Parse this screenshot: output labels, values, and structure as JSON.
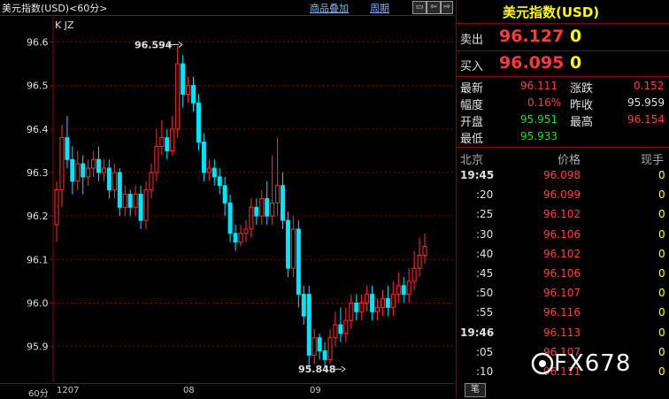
{
  "header": {
    "title": "美元指数(USD)<60分>",
    "links": [
      "商品叠加",
      "周期"
    ],
    "btns": [
      "▭",
      "⇦",
      "⇨",
      "▭"
    ]
  },
  "chart": {
    "indicator": "K JZ",
    "high_marker": "96.594",
    "low_marker": "95.848",
    "yticks": [
      "96.6",
      "96.5",
      "96.4",
      "96.3",
      "96.2",
      "96.1",
      "96.0",
      "95.9"
    ],
    "xlabels": [
      "60分",
      "1207",
      "08",
      "09"
    ],
    "colors": {
      "up": "#ff3030",
      "down": "#00e5ff",
      "grid": "#8b0000",
      "axis": "#8b0000"
    }
  },
  "chart_data": {
    "type": "candlestick",
    "ylim": [
      95.82,
      96.66
    ],
    "yticks": [
      96.6,
      96.5,
      96.4,
      96.3,
      96.2,
      96.1,
      96.0,
      95.9
    ],
    "candles": [
      [
        96.18,
        96.26,
        96.14,
        96.28
      ],
      [
        96.26,
        96.38,
        96.22,
        96.41
      ],
      [
        96.38,
        96.33,
        96.31,
        96.43
      ],
      [
        96.33,
        96.28,
        96.25,
        96.36
      ],
      [
        96.28,
        96.32,
        96.26,
        96.35
      ],
      [
        96.32,
        96.29,
        96.25,
        96.34
      ],
      [
        96.29,
        96.31,
        96.27,
        96.33
      ],
      [
        96.31,
        96.33,
        96.29,
        96.35
      ],
      [
        96.33,
        96.3,
        96.28,
        96.36
      ],
      [
        96.3,
        96.31,
        96.28,
        96.33
      ],
      [
        96.31,
        96.26,
        96.24,
        96.33
      ],
      [
        96.26,
        96.3,
        96.24,
        96.32
      ],
      [
        96.3,
        96.22,
        96.2,
        96.31
      ],
      [
        96.22,
        96.25,
        96.2,
        96.27
      ],
      [
        96.25,
        96.22,
        96.2,
        96.26
      ],
      [
        96.22,
        96.25,
        96.2,
        96.27
      ],
      [
        96.25,
        96.19,
        96.17,
        96.27
      ],
      [
        96.19,
        96.26,
        96.17,
        96.28
      ],
      [
        96.26,
        96.3,
        96.24,
        96.32
      ],
      [
        96.3,
        96.36,
        96.28,
        96.4
      ],
      [
        96.36,
        96.38,
        96.34,
        96.42
      ],
      [
        96.38,
        96.35,
        96.33,
        96.4
      ],
      [
        96.35,
        96.4,
        96.34,
        96.43
      ],
      [
        96.4,
        96.55,
        96.38,
        96.59
      ],
      [
        96.55,
        96.48,
        96.45,
        96.57
      ],
      [
        96.48,
        96.5,
        96.46,
        96.52
      ],
      [
        96.5,
        96.46,
        96.44,
        96.52
      ],
      [
        96.46,
        96.37,
        96.35,
        96.48
      ],
      [
        96.37,
        96.3,
        96.28,
        96.39
      ],
      [
        96.3,
        96.31,
        96.28,
        96.33
      ],
      [
        96.31,
        96.29,
        96.27,
        96.33
      ],
      [
        96.29,
        96.27,
        96.25,
        96.31
      ],
      [
        96.27,
        96.23,
        96.2,
        96.29
      ],
      [
        96.23,
        96.16,
        96.14,
        96.25
      ],
      [
        96.16,
        96.14,
        96.12,
        96.18
      ],
      [
        96.14,
        96.16,
        96.13,
        96.18
      ],
      [
        96.16,
        96.17,
        96.14,
        96.19
      ],
      [
        96.17,
        96.22,
        96.15,
        96.24
      ],
      [
        96.22,
        96.2,
        96.18,
        96.24
      ],
      [
        96.2,
        96.24,
        96.18,
        96.26
      ],
      [
        96.24,
        96.2,
        96.18,
        96.28
      ],
      [
        96.2,
        96.23,
        96.18,
        96.34
      ],
      [
        96.23,
        96.27,
        96.2,
        96.38
      ],
      [
        96.27,
        96.19,
        96.17,
        96.3
      ],
      [
        96.19,
        96.08,
        96.06,
        96.21
      ],
      [
        96.08,
        96.17,
        96.06,
        96.2
      ],
      [
        96.17,
        96.02,
        95.99,
        96.19
      ],
      [
        96.02,
        95.97,
        95.95,
        96.04
      ],
      [
        96.02,
        95.88,
        95.85,
        96.04
      ],
      [
        95.88,
        95.92,
        95.86,
        95.94
      ],
      [
        95.92,
        95.89,
        95.87,
        95.93
      ],
      [
        95.89,
        95.87,
        95.85,
        95.91
      ],
      [
        95.87,
        95.92,
        95.86,
        95.94
      ],
      [
        95.92,
        95.95,
        95.9,
        95.98
      ],
      [
        95.95,
        95.93,
        95.91,
        95.99
      ],
      [
        95.93,
        95.96,
        95.91,
        95.99
      ],
      [
        95.96,
        96.0,
        95.94,
        96.02
      ],
      [
        96.0,
        95.98,
        95.96,
        96.02
      ],
      [
        95.98,
        96.0,
        95.96,
        96.02
      ],
      [
        96.0,
        96.02,
        95.98,
        96.04
      ],
      [
        96.02,
        95.98,
        95.96,
        96.04
      ],
      [
        95.98,
        95.99,
        95.96,
        96.01
      ],
      [
        95.99,
        96.01,
        95.97,
        96.03
      ],
      [
        96.01,
        95.99,
        95.97,
        96.04
      ],
      [
        95.99,
        96.02,
        95.97,
        96.05
      ],
      [
        96.02,
        96.04,
        96.0,
        96.07
      ],
      [
        96.04,
        96.02,
        96.0,
        96.06
      ],
      [
        96.02,
        96.05,
        96.0,
        96.08
      ],
      [
        96.05,
        96.08,
        96.03,
        96.12
      ],
      [
        96.08,
        96.11,
        96.06,
        96.15
      ],
      [
        96.11,
        96.13,
        96.09,
        96.16
      ]
    ]
  },
  "panel": {
    "title": "美元指数(USD)",
    "sell_label": "卖出",
    "sell_price": "96.127",
    "sell_vol": "0",
    "buy_label": "买入",
    "buy_price": "96.095",
    "buy_vol": "0",
    "latest_label": "最新",
    "latest": "96.111",
    "change_label": "涨跌",
    "change": "0.152",
    "range_label": "幅度",
    "range": "0.16%",
    "prevclose_label": "昨收",
    "prevclose": "95.959",
    "open_label": "开盘",
    "open": "95.951",
    "high_label": "最高",
    "high": "96.154",
    "low_label": "最低",
    "low": "95.933",
    "col_time": "北京",
    "col_price": "价格",
    "col_vol": "现手",
    "ticks": [
      {
        "time": "19:45",
        "price": "96.098",
        "vol": "0"
      },
      {
        "time": ":20",
        "price": "96.099",
        "vol": "0"
      },
      {
        "time": ":25",
        "price": "96.102",
        "vol": "0"
      },
      {
        "time": ":30",
        "price": "96.106",
        "vol": "0"
      },
      {
        "time": ":40",
        "price": "96.102",
        "vol": "0"
      },
      {
        "time": ":45",
        "price": "96.106",
        "vol": "0"
      },
      {
        "time": ":50",
        "price": "96.107",
        "vol": "0"
      },
      {
        "time": ":55",
        "price": "96.116",
        "vol": "0"
      },
      {
        "time": "19:46",
        "price": "96.113",
        "vol": "0"
      },
      {
        "time": ":05",
        "price": "96.107",
        "vol": "0"
      },
      {
        "time": ":10",
        "price": "96.111",
        "vol": "0"
      }
    ],
    "tab_label": "笔"
  },
  "watermark": "FX678"
}
